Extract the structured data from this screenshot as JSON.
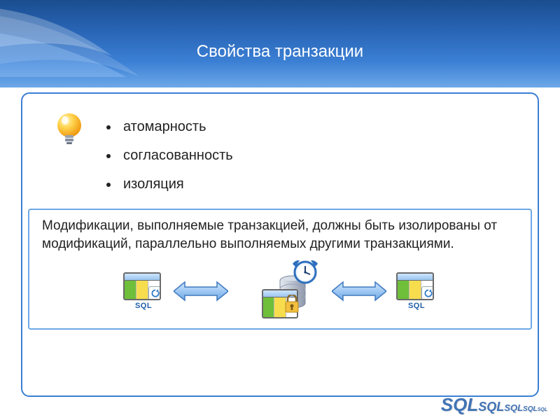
{
  "title": "Свойства транзакции",
  "bullets": [
    "атомарность",
    "согласованность",
    "изоляция"
  ],
  "callout": "Модификации, выполняемые транзакцией, должны быть изолированы от модификаций, параллельно выполняемых другими транзакциями.",
  "sql_label": "SQL",
  "footer_logo": "SQL",
  "diagram": {
    "left_db": "SQL database table with refresh",
    "right_db": "SQL database table with refresh",
    "center": {
      "table": "data table",
      "storage": "database cylinder",
      "lock": "padlock (isolation)",
      "clock": "analog clock"
    },
    "arrows": "bidirectional"
  }
}
